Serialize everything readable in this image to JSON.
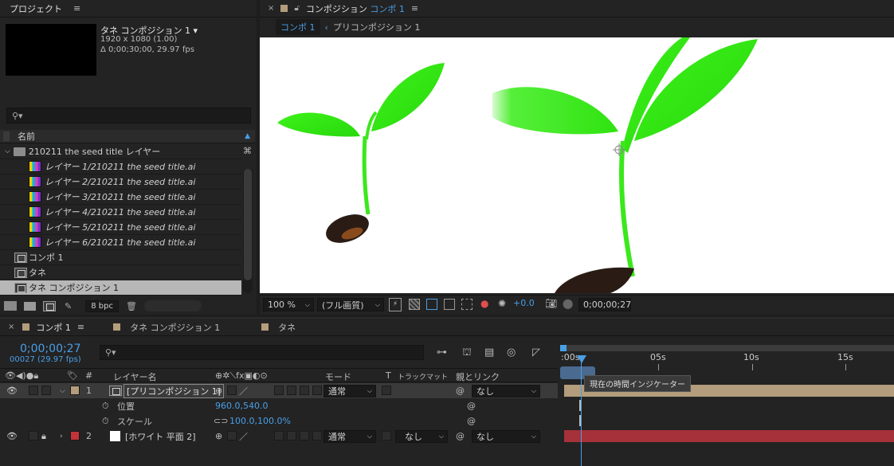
{
  "project_panel": {
    "title": "プロジェクト",
    "menu_icon": "hamburger-icon",
    "selected_name": "タネ コンポジション 1 ▾",
    "selected_size": "1920 x 1080 (1.00)",
    "selected_duration": "Δ 0;00;30;00, 29.97 fps",
    "search_placeholder": "",
    "column_name": "名前",
    "folder": "210211 the seed title レイヤー",
    "layers": [
      "レイヤー 1/210211 the seed title.ai",
      "レイヤー 2/210211 the seed title.ai",
      "レイヤー 3/210211 the seed title.ai",
      "レイヤー 4/210211 the seed title.ai",
      "レイヤー 5/210211 the seed title.ai",
      "レイヤー 6/210211 the seed title.ai"
    ],
    "comps": [
      "コンポ 1",
      "タネ",
      "タネ コンポジション 1"
    ],
    "bpc": "8 bpc"
  },
  "viewer": {
    "tab_label": "コンポジション",
    "tab_comp": "コンポ 1",
    "breadcrumb_active": "コンポ 1",
    "breadcrumb_next": "プリコンポジション 1",
    "zoom": "100 %",
    "quality": "(フル画質)",
    "exposure": "+0.0",
    "timecode": "0;00;00;27"
  },
  "timeline": {
    "tabs": [
      "コンポ 1",
      "タネ コンポジション 1",
      "タネ"
    ],
    "current_time": "0;00;00;27",
    "frame_info": "00027 (29.97 fps)",
    "col_layer_name": "レイヤー名",
    "col_mode": "モード",
    "col_t": "T",
    "col_trackmatte": "トラックマット",
    "col_parent": "親とリンク",
    "col_number": "#",
    "ruler_labels": [
      ":00s",
      "05s",
      "10s",
      "15s"
    ],
    "tooltip": "現在の時間インジケーター",
    "layers": [
      {
        "num": "1",
        "name": "[プリコンポジション 1]",
        "mode": "通常",
        "parent": "なし",
        "color": "#b39d7c"
      },
      {
        "num": "2",
        "name": "[ホワイト 平面 2]",
        "mode": "通常",
        "trackmatte": "なし",
        "parent": "なし",
        "color": "#c1343a"
      }
    ],
    "props": [
      {
        "name": "位置",
        "value": "960.0,540.0"
      },
      {
        "name": "スケール",
        "value": "100.0,100.0%"
      }
    ]
  }
}
